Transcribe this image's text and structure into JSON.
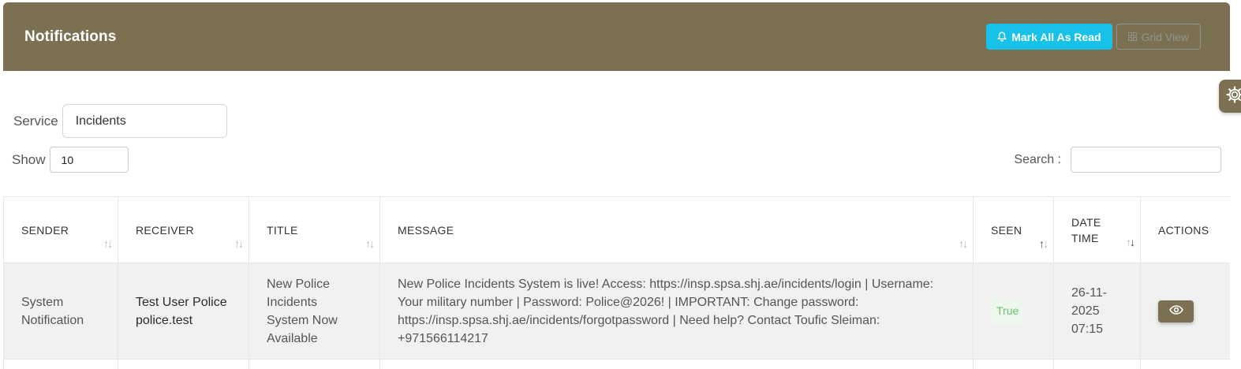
{
  "header": {
    "title": "Notifications",
    "mark_all_label": "Mark All As Read",
    "grid_view_label": "Grid View"
  },
  "filters": {
    "service_label": "Service",
    "service_value": "Incidents",
    "show_label": "Show",
    "show_value": "10",
    "search_label": "Search :",
    "search_value": ""
  },
  "table": {
    "columns": {
      "sender": "SENDER",
      "receiver": "RECEIVER",
      "title": "TITLE",
      "message": "MESSAGE",
      "seen": "SEEN",
      "datetime_line1": "DATE",
      "datetime_line2": "TIME",
      "actions": "ACTIONS"
    },
    "rows": [
      {
        "sender_line1": "System",
        "sender_line2": "Notification",
        "receiver_line1": "Test User Police",
        "receiver_line2": "police.test",
        "title_lines": [
          "New Police",
          "Incidents",
          "System Now",
          "Available"
        ],
        "message": "New Police Incidents System is live! Access: https://insp.spsa.shj.ae/incidents/login | Username: Your military number | Password: Police@2026! | IMPORTANT: Change password: https://insp.spsa.shj.ae/incidents/forgotpassword | Need help? Contact Toufic Sleiman: +971566114217",
        "seen": "True",
        "date_line1": "26-11-",
        "date_line2": "2025",
        "date_line3": "07:15"
      }
    ]
  },
  "icons": {
    "bell": "bell-icon",
    "grid": "grid-icon",
    "eye": "eye-icon",
    "gear": "gear-icon"
  },
  "colors": {
    "brand": "#7b7052",
    "accent": "#17c1e8",
    "seen_text": "#6cc06a"
  }
}
